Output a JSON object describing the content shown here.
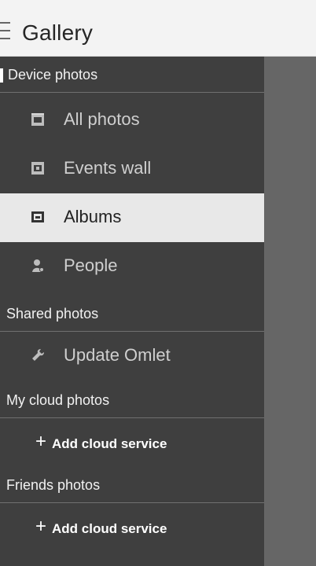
{
  "header": {
    "title": "Gallery"
  },
  "drawer": {
    "sections": [
      {
        "label": "Device photos",
        "items": [
          {
            "label": "All photos",
            "icon": "photos-icon"
          },
          {
            "label": "Events wall",
            "icon": "events-wall-icon"
          },
          {
            "label": "Albums",
            "icon": "albums-icon",
            "selected": true
          },
          {
            "label": "People",
            "icon": "people-icon"
          }
        ]
      },
      {
        "label": "Shared photos",
        "items": [
          {
            "label": "Update Omlet",
            "icon": "wrench-icon"
          }
        ]
      },
      {
        "label": "My cloud photos",
        "action": {
          "plus": "+",
          "label": "Add cloud service"
        }
      },
      {
        "label": "Friends photos",
        "action": {
          "plus": "+",
          "label": "Add cloud service"
        }
      }
    ]
  },
  "colors": {
    "header_bg": "#f3f3f3",
    "drawer_bg": "#3f3f3f",
    "content_bg": "#666666",
    "selected_bg": "#e8e8e8"
  }
}
